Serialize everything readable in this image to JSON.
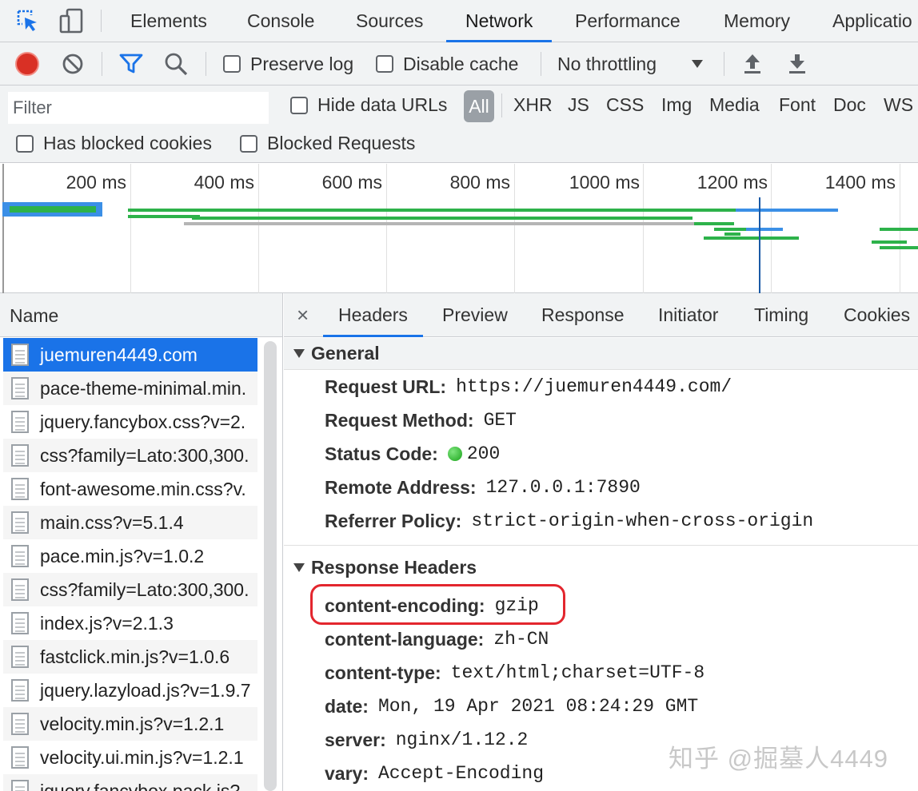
{
  "devtools_tabs": [
    "Elements",
    "Console",
    "Sources",
    "Network",
    "Performance",
    "Memory",
    "Applicatio"
  ],
  "active_tab": "Network",
  "toolbar": {
    "record_icon": "record-icon",
    "clear_icon": "clear-icon",
    "filter_icon": "filter-icon",
    "search_icon": "search-icon",
    "preserve_log": "Preserve log",
    "disable_cache": "Disable cache",
    "throttling": "No throttling",
    "import_icon": "upload-icon",
    "export_icon": "download-icon"
  },
  "filter": {
    "placeholder": "Filter",
    "hide_data_urls": "Hide data URLs",
    "types": [
      "All",
      "XHR",
      "JS",
      "CSS",
      "Img",
      "Media",
      "Font",
      "Doc",
      "WS"
    ],
    "has_blocked_cookies": "Has blocked cookies",
    "blocked_requests": "Blocked Requests"
  },
  "overview": {
    "ticks": [
      "200 ms",
      "400 ms",
      "600 ms",
      "800 ms",
      "1000 ms",
      "1200 ms",
      "1400 ms"
    ]
  },
  "name_panel": {
    "header": "Name",
    "rows": [
      "juemuren4449.com",
      "pace-theme-minimal.min.",
      "jquery.fancybox.css?v=2.",
      "css?family=Lato:300,300.",
      "font-awesome.min.css?v.",
      "main.css?v=5.1.4",
      "pace.min.js?v=1.0.2",
      "css?family=Lato:300,300.",
      "index.js?v=2.1.3",
      "fastclick.min.js?v=1.0.6",
      "jquery.lazyload.js?v=1.9.7",
      "velocity.min.js?v=1.2.1",
      "velocity.ui.min.js?v=1.2.1",
      "jquery.fancybox.pack.js?"
    ]
  },
  "detail": {
    "close": "×",
    "tabs": [
      "Headers",
      "Preview",
      "Response",
      "Initiator",
      "Timing",
      "Cookies"
    ],
    "general": {
      "title": "General",
      "request_url_k": "Request URL:",
      "request_url_v": "https://juemuren4449.com/",
      "method_k": "Request Method:",
      "method_v": "GET",
      "status_k": "Status Code:",
      "status_v": "200",
      "remote_k": "Remote Address:",
      "remote_v": "127.0.0.1:7890",
      "referrer_k": "Referrer Policy:",
      "referrer_v": "strict-origin-when-cross-origin"
    },
    "response_headers": {
      "title": "Response Headers",
      "items": [
        {
          "k": "content-encoding:",
          "v": "gzip"
        },
        {
          "k": "content-language:",
          "v": "zh-CN"
        },
        {
          "k": "content-type:",
          "v": "text/html;charset=UTF-8"
        },
        {
          "k": "date:",
          "v": "Mon, 19 Apr 2021 08:24:29 GMT"
        },
        {
          "k": "server:",
          "v": "nginx/1.12.2"
        },
        {
          "k": "vary:",
          "v": "Accept-Encoding"
        }
      ]
    }
  },
  "watermark": "知乎 @掘墓人4449",
  "colors": {
    "accent": "#1a73e8",
    "record": "#d93025",
    "highlight": "#e3262e",
    "status_ok": "#1aa31a"
  }
}
